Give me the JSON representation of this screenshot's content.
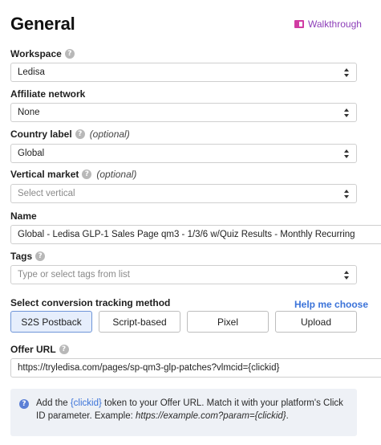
{
  "header": {
    "title": "General",
    "walkthrough_label": "Walkthrough"
  },
  "workspace": {
    "label": "Workspace",
    "value": "Ledisa"
  },
  "affiliate": {
    "label": "Affiliate network",
    "value": "None"
  },
  "country": {
    "label": "Country label",
    "optional": "(optional)",
    "value": "Global"
  },
  "vertical": {
    "label": "Vertical market",
    "optional": "(optional)",
    "placeholder": "Select vertical"
  },
  "name": {
    "label": "Name",
    "value": "Global - Ledisa GLP-1 Sales Page qm3 - 1/3/6 w/Quiz Results - Monthly Recurring"
  },
  "tags": {
    "label": "Tags",
    "placeholder": "Type or select tags from list"
  },
  "tracking": {
    "label": "Select conversion tracking method",
    "help_link": "Help me choose",
    "methods": [
      "S2S Postback",
      "Script-based",
      "Pixel",
      "Upload"
    ],
    "selected": "S2S Postback"
  },
  "offer": {
    "label": "Offer URL",
    "value": "https://tryledisa.com/pages/sp-qm3-glp-patches?vlmcid={clickid}"
  },
  "info": {
    "text_1": "Add the ",
    "token": "{clickid}",
    "text_2": " token to your Offer URL. Match it with your platform's Click ID parameter. Example: ",
    "example": "https://example.com?param={clickid}",
    "text_3": "."
  },
  "icons": {
    "help": "question-mark-icon",
    "walkthrough": "book-icon",
    "select": "chevron-updown-icon"
  }
}
